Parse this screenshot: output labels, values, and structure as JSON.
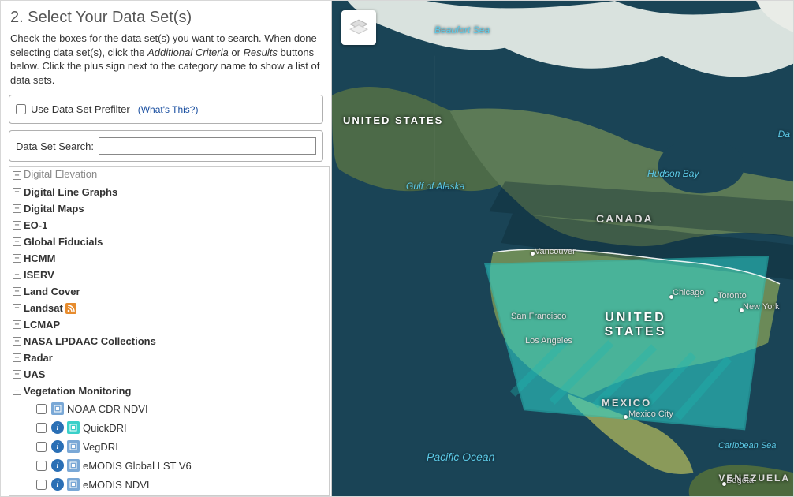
{
  "heading": "2. Select Your Data Set(s)",
  "instructions_pre": "Check the boxes for the data set(s) you want to search. When done selecting data set(s), click the ",
  "instructions_em1": "Additional Criteria",
  "instructions_mid": " or ",
  "instructions_em2": "Results",
  "instructions_post": " buttons below. Click the plus sign next to the category name to show a list of data sets.",
  "prefilter_label": "Use Data Set Prefilter",
  "whats_this": "(What's This?)",
  "search_label": "Data Set Search:",
  "search_value": "",
  "tree": {
    "digital_elevation": "Digital Elevation",
    "digital_line_graphs": "Digital Line Graphs",
    "digital_maps": "Digital Maps",
    "eo1": "EO-1",
    "global_fiducials": "Global Fiducials",
    "hcmm": "HCMM",
    "iserv": "ISERV",
    "land_cover": "Land Cover",
    "landsat": "Landsat",
    "lcmap": "LCMAP",
    "nasa_lpdaac": "NASA LPDAAC Collections",
    "radar": "Radar",
    "uas": "UAS",
    "vegetation_monitoring": "Vegetation Monitoring",
    "veg_items": {
      "noaa_cdr_ndvi": "NOAA CDR NDVI",
      "quickdri": "QuickDRI",
      "vegdri": "VegDRI",
      "emodis_global_lst": "eMODIS Global LST V6",
      "emodis_ndvi": "eMODIS NDVI"
    }
  },
  "map_labels": {
    "beaufort_sea": "Beaufort Sea",
    "united_states_ak": "UNITED STATES",
    "gulf_of_alaska": "Gulf of Alaska",
    "hudson_bay": "Hudson Bay",
    "canada": "CANADA",
    "da": "Da",
    "vancouver": "Vancouver",
    "united_states_big": "UNITED STATES",
    "san_francisco": "San Francisco",
    "los_angeles": "Los Angeles",
    "chicago": "Chicago",
    "toronto": "Toronto",
    "new_york": "New York",
    "mexico": "MEXICO",
    "mexico_city": "Mexico City",
    "pacific_ocean": "Pacific Ocean",
    "caribbean_sea": "Caribbean Sea",
    "bogota": "Bogota",
    "venezuela": "VENEZUELA"
  }
}
